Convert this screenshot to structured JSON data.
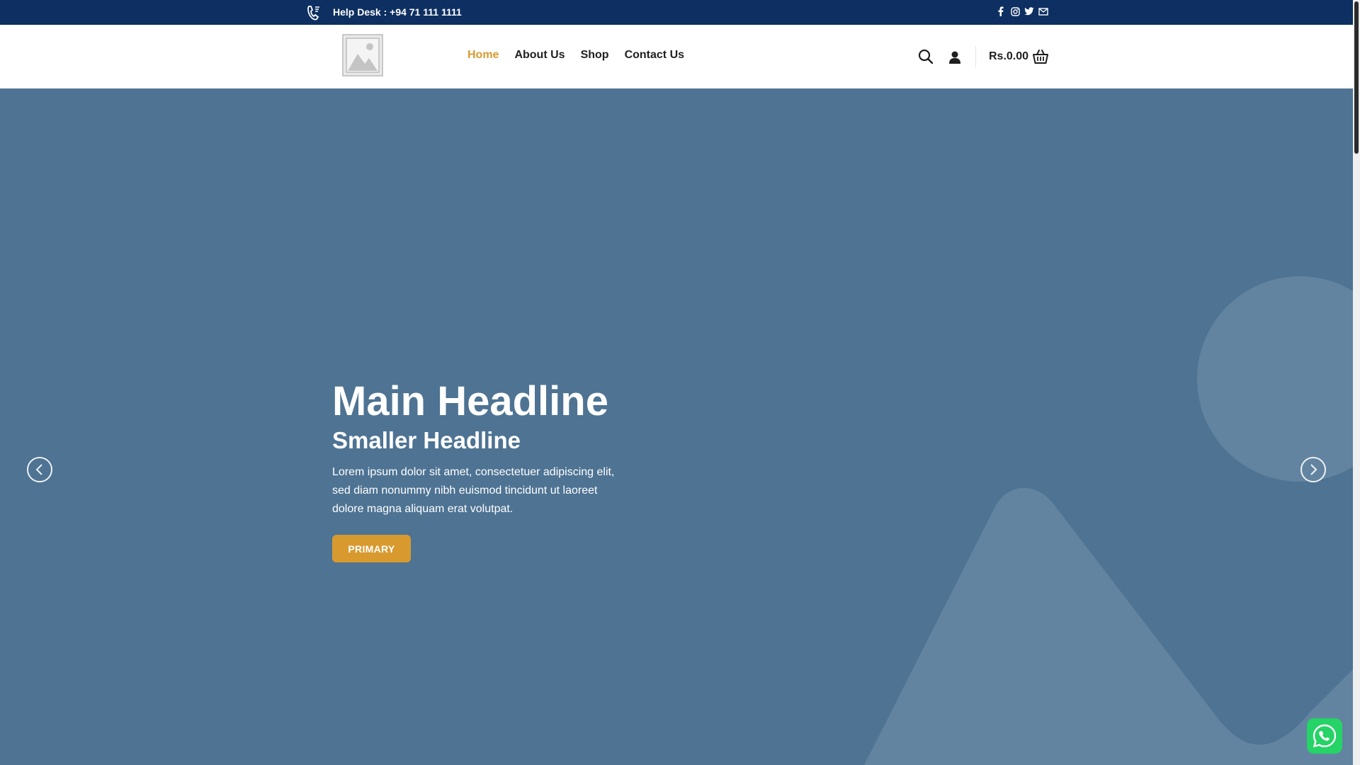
{
  "topbar": {
    "helpdesk": "Help Desk : +94 71 111 1111",
    "social": [
      "facebook-icon",
      "instagram-icon",
      "twitter-icon",
      "email-icon"
    ]
  },
  "header": {
    "nav": [
      {
        "label": "Home",
        "active": true
      },
      {
        "label": "About Us",
        "active": false
      },
      {
        "label": "Shop",
        "active": false
      },
      {
        "label": "Contact Us",
        "active": false
      }
    ],
    "cart_total": "Rs.0.00"
  },
  "hero": {
    "headline": "Main Headline",
    "subheadline": "Smaller Headline",
    "body": "Lorem ipsum dolor sit amet, consectetuer adipiscing elit, sed diam nonummy nibh euismod tincidunt ut laoreet dolore magna aliquam erat volutpat.",
    "button": "PRIMARY"
  },
  "colors": {
    "topbar": "#0d2f61",
    "accent": "#d89a2f",
    "hero_bg": "#4e7393",
    "whatsapp": "#25d366"
  }
}
